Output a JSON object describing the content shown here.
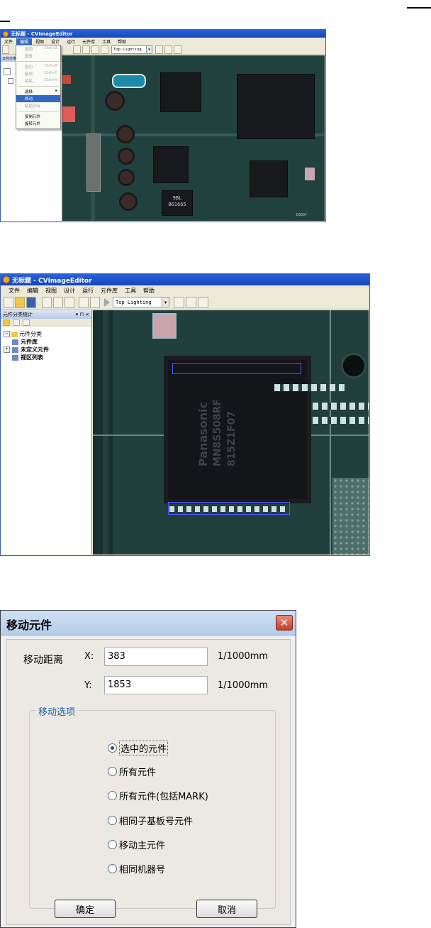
{
  "screenshot1": {
    "title": "无标题 - CVImageEditor",
    "menu": [
      "文件",
      "编辑",
      "视图",
      "设计",
      "运行",
      "元件库",
      "工具",
      "帮助"
    ],
    "lighting": "Top Lighting",
    "panel_title": "元件分类统计",
    "edit_menu": [
      {
        "label": "撤销",
        "shortcut": "Ctrl+Z",
        "disabled": true
      },
      {
        "label": "重复",
        "shortcut": "",
        "disabled": true
      },
      {
        "label": "剪切",
        "shortcut": "Ctrl+X",
        "disabled": true
      },
      {
        "label": "复制",
        "shortcut": "Ctrl+C",
        "disabled": true
      },
      {
        "label": "粘贴",
        "shortcut": "Ctrl+V",
        "disabled": true
      },
      {
        "label": "选择",
        "shortcut": "▸",
        "disabled": false
      },
      {
        "label": "移动",
        "shortcut": "",
        "disabled": false,
        "selected": true
      },
      {
        "label": "粘贴所有",
        "shortcut": "",
        "disabled": true
      },
      {
        "label": "复制元件",
        "shortcut": "",
        "disabled": false
      },
      {
        "label": "旋转元件",
        "shortcut": "",
        "disabled": false
      }
    ],
    "chip_text": [
      "9BL",
      "861665"
    ],
    "board_mark": "D689Y"
  },
  "screenshot2": {
    "title": "无标题 - CVImageEditor",
    "menu": [
      "文件",
      "编辑",
      "视图",
      "设计",
      "运行",
      "元件库",
      "工具",
      "帮助"
    ],
    "lighting": "Top Lighting",
    "panel_title": "元件分类统计",
    "panel_controls": "▾ ⊓ ×",
    "tree": [
      {
        "label": "元件分类",
        "level": 0
      },
      {
        "label": "元件库",
        "level": 1
      },
      {
        "label": "未定义元件",
        "level": 1
      },
      {
        "label": "视区列表",
        "level": 1
      }
    ],
    "chip_text": [
      "Panasonic",
      "MN8S508RF",
      "815Z1F07"
    ]
  },
  "dialog": {
    "title": "移动元件",
    "close": "✕",
    "distance_label": "移动距离",
    "x_label": "X:",
    "x_value": "383",
    "y_label": "Y:",
    "y_value": "1853",
    "unit": "1/1000mm",
    "group_title": "移动选项",
    "options": [
      {
        "label": "选中的元件",
        "checked": true
      },
      {
        "label": "所有元件",
        "checked": false
      },
      {
        "label": "所有元件(包括MARK)",
        "checked": false
      },
      {
        "label": "相同子基板号元件",
        "checked": false
      },
      {
        "label": "移动主元件",
        "checked": false
      },
      {
        "label": "相同机器号",
        "checked": false
      }
    ],
    "ok": "确定",
    "cancel": "取消"
  }
}
